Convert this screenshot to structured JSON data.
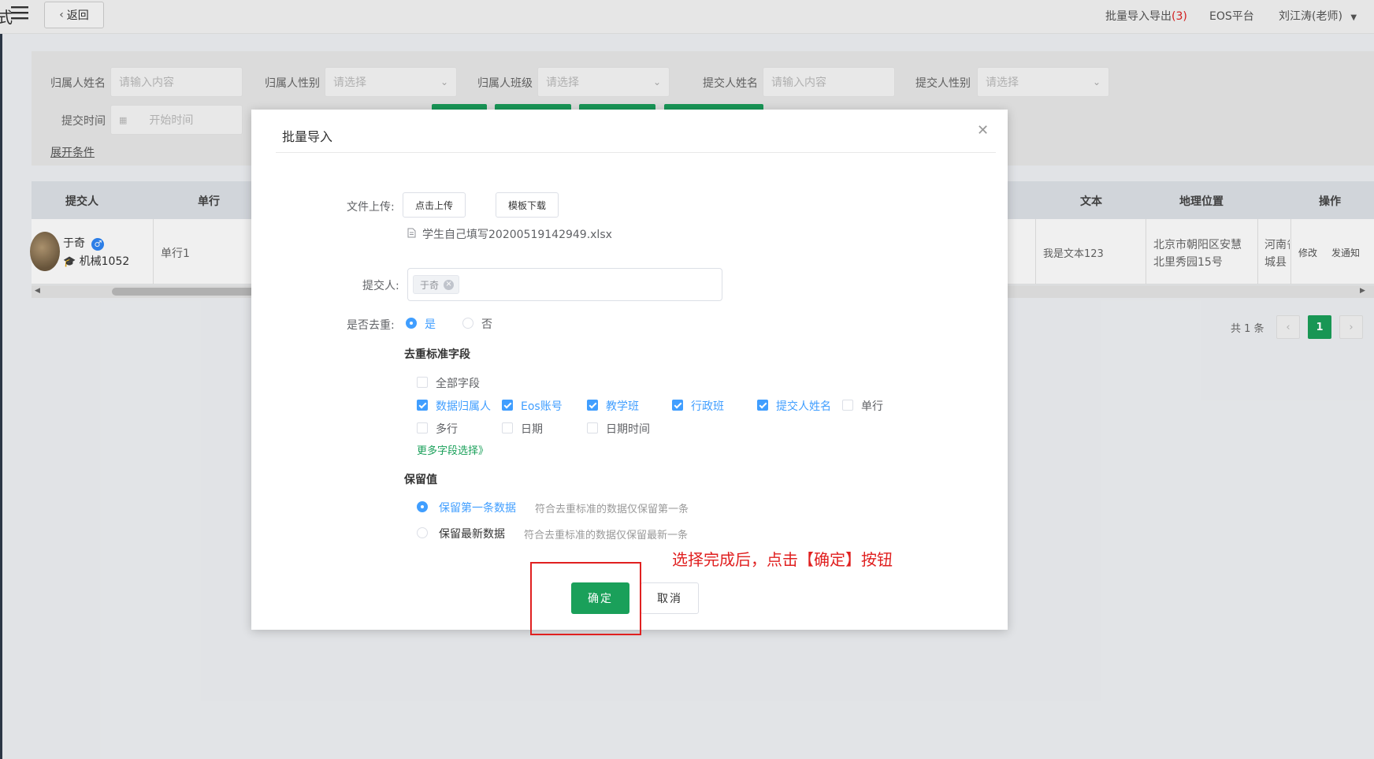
{
  "topbar": {
    "edge_char": "式",
    "back_label": "返回",
    "import_export_label": "批量导入导出",
    "import_export_count": "(3)",
    "eos_label": "EOS平台",
    "user_label": "刘江涛(老师)"
  },
  "filters": {
    "owner_name_label": "归属人姓名",
    "owner_name_placeholder": "请输入内容",
    "owner_gender_label": "归属人性别",
    "owner_gender_placeholder": "请选择",
    "owner_class_label": "归属人班级",
    "owner_class_placeholder": "请选择",
    "submitter_name_label": "提交人姓名",
    "submitter_name_placeholder": "请输入内容",
    "submitter_gender_label": "提交人性别",
    "submitter_gender_placeholder": "请选择",
    "submit_time_label": "提交时间",
    "start_time_placeholder": "开始时间",
    "expand_label": "展开条件"
  },
  "table": {
    "headers": {
      "submitter": "提交人",
      "single_line": "单行",
      "text": "文本",
      "location": "地理位置",
      "actions": "操作"
    },
    "row": {
      "name": "于奇",
      "class": "机械1052",
      "single_line": "单行1",
      "text": "我是文本123",
      "location_line1": "北京市朝阳区安慧",
      "location_line2": "北里秀园15号",
      "extra_line1": "河南省",
      "extra_line2": "城县",
      "edit_label": "修改",
      "notify_label": "发通知"
    }
  },
  "pager": {
    "total": "共 1 条",
    "current_page": "1"
  },
  "modal": {
    "title": "批量导入",
    "file_upload_label": "文件上传:",
    "upload_button": "点击上传",
    "template_button": "模板下载",
    "file_name": "学生自己填写20200519142949.xlsx",
    "submitter_label": "提交人:",
    "submitter_tag": "于奇",
    "dedup_label": "是否去重:",
    "dedup_yes": "是",
    "dedup_no": "否",
    "criteria_title": "去重标准字段",
    "fields": {
      "all": "全部字段",
      "data_owner": "数据归属人",
      "eos_account": "Eos账号",
      "teaching_class": "教学班",
      "admin_class": "行政班",
      "submitter_name": "提交人姓名",
      "single_line": "单行",
      "multi_line": "多行",
      "date": "日期",
      "datetime": "日期时间"
    },
    "more_fields": "更多字段选择》",
    "retain_title": "保留值",
    "retain_first": "保留第一条数据",
    "retain_first_hint": "符合去重标准的数据仅保留第一条",
    "retain_latest": "保留最新数据",
    "retain_latest_hint": "符合去重标准的数据仅保留最新一条",
    "confirm": "确定",
    "cancel": "取消"
  },
  "annotation": "选择完成后，点击【确定】按钮",
  "colors": {
    "primary_green": "#1aa05a",
    "checkbox_blue": "#409eff",
    "annotation_red": "#e02020"
  }
}
